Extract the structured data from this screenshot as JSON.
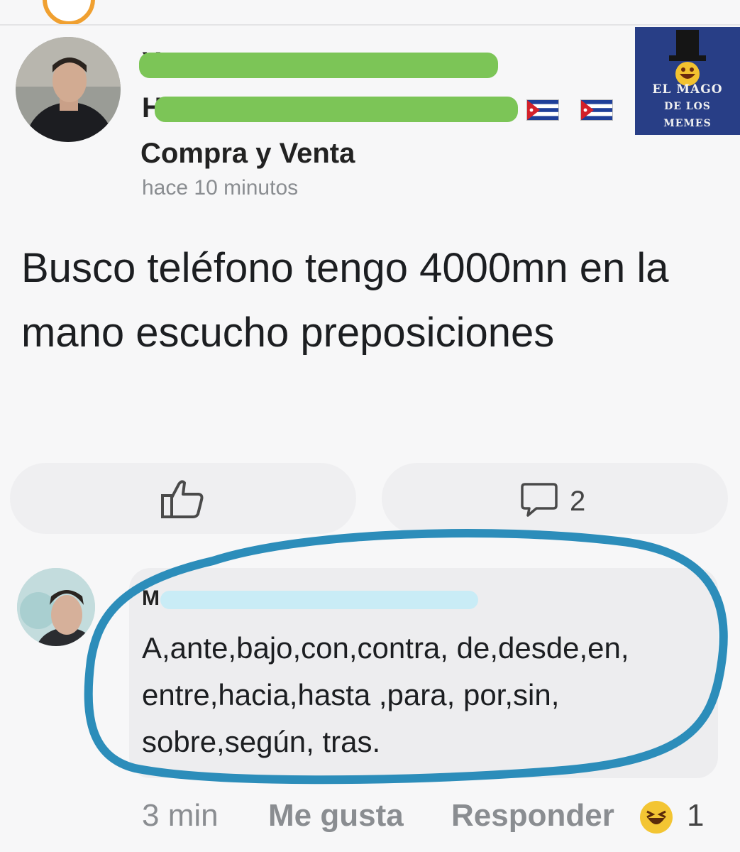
{
  "post": {
    "author_line1_visible": "Y",
    "author_line2_visible": "H",
    "group": "Compra y Venta",
    "time": "hace 10 minutos",
    "body": "Busco teléfono tengo 4000mn en la mano escucho preposiciones"
  },
  "watermark": {
    "line1": "EL MAGO",
    "line2": "DE LOS",
    "line3": "MEMES"
  },
  "actions": {
    "like_icon": "thumbs-up-icon",
    "comment_icon": "comment-bubble-icon",
    "comment_count": "2"
  },
  "comment": {
    "author_visible": "M",
    "text": "A,ante,bajo,con,contra, de,desde,en, entre,hacia,hasta ,para, por,sin, sobre,según, tras.",
    "time": "3 min",
    "like_label": "Me gusta",
    "reply_label": "Responder",
    "reaction_icon": "laughing-emoji-icon",
    "reaction_count": "1"
  },
  "colors": {
    "redaction_green": "#7cc557",
    "redaction_blue": "#c9ecf6",
    "highlight_outline": "#2c8dba",
    "watermark_bg": "#283e86"
  }
}
